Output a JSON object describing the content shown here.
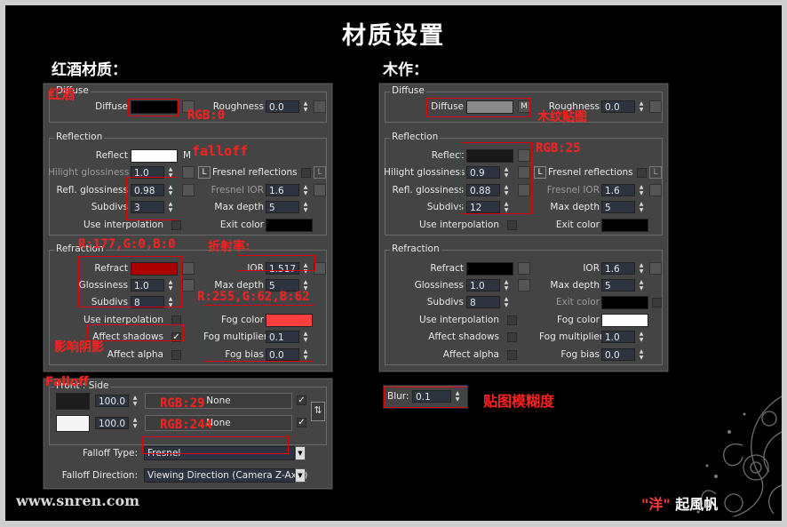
{
  "title": "材质设置",
  "left_heading": "红酒材质：",
  "right_heading": "木作：",
  "footer_site": "www.snren.com",
  "footer_author_q": "\"洋\"",
  "footer_author_rest": "起風帆",
  "colors": {
    "wine_refract": "#aa0000",
    "fog_color_wine": "#ff3e3e",
    "annotation": "#ff2020"
  },
  "left": {
    "diffuse_group": "Diffuse",
    "diffuse_label": "Diffuse",
    "roughness_label": "Roughness",
    "roughness_value": "0.0",
    "reflection_group": "Reflection",
    "reflect_label": "Reflect",
    "m_label": "M",
    "hilight_label": "Hilight glossiness",
    "hilight_value": "1.0",
    "l_label": "L",
    "fresnel_label": "Fresnel reflections",
    "refl_gloss_label": "Refl. glossiness",
    "refl_gloss_value": "0.98",
    "fresnel_ior_label": "Fresnel IOR",
    "fresnel_ior_value": "1.6",
    "subdivs_label": "Subdivs",
    "subdivs_value": "3",
    "max_depth_label": "Max depth",
    "max_depth_value": "5",
    "use_interp_label": "Use interpolation",
    "exit_color_label": "Exit color",
    "refraction_group": "Refraction",
    "refract_label": "Refract",
    "ior_label": "IOR",
    "ior_value": "1.517",
    "glossiness_label": "Glossiness",
    "glossiness_value": "1.0",
    "r_max_depth_label": "Max depth",
    "r_max_depth_value": "5",
    "r_subdivs_label": "Subdivs",
    "r_subdivs_value": "8",
    "r_use_interp_label": "Use interpolation",
    "fog_color_label": "Fog color",
    "affect_shadows_label": "Affect shadows",
    "fog_mult_label": "Fog multiplier",
    "fog_mult_value": "0.1",
    "affect_alpha_label": "Affect alpha",
    "fog_bias_label": "Fog bias",
    "fog_bias_value": "0.0"
  },
  "falloff": {
    "group": "Front : Side",
    "val1": "100.0",
    "none1": "None",
    "val2": "100.0",
    "none2": "None",
    "type_label": "Falloff Type:",
    "type_value": "Fresnel",
    "dir_label": "Falloff Direction:",
    "dir_value": "Viewing Direction (Camera Z-Axis)"
  },
  "right": {
    "diffuse_group": "Diffuse",
    "diffuse_label": "Diffuse",
    "m_label": "M",
    "roughness_label": "Roughness",
    "roughness_value": "0.0",
    "reflection_group": "Reflection",
    "reflect_label": "Reflect",
    "hilight_label": "Hilight glossiness",
    "hilight_value": "0.9",
    "l_label": "L",
    "fresnel_label": "Fresnel reflections",
    "refl_gloss_label": "Refl. glossiness",
    "refl_gloss_value": "0.88",
    "fresnel_ior_label": "Fresnel IOR",
    "fresnel_ior_value": "1.6",
    "subdivs_label": "Subdivs",
    "subdivs_value": "12",
    "max_depth_label": "Max depth",
    "max_depth_value": "5",
    "use_interp_label": "Use interpolation",
    "exit_color_label": "Exit color",
    "refraction_group": "Refraction",
    "refract_label": "Refract",
    "ior_label": "IOR",
    "ior_value": "1.6",
    "glossiness_label": "Glossiness",
    "glossiness_value": "1.0",
    "r_max_depth_label": "Max depth",
    "r_max_depth_value": "5",
    "r_subdivs_label": "Subdivs",
    "r_subdivs_value": "8",
    "r_exit_color_label": "Exit color",
    "r_use_interp_label": "Use interpolation",
    "fog_color_label": "Fog color",
    "affect_shadows_label": "Affect shadows",
    "fog_mult_label": "Fog multiplier",
    "fog_mult_value": "1.0",
    "affect_alpha_label": "Affect alpha",
    "fog_bias_label": "Fog bias",
    "fog_bias_value": "0.0"
  },
  "blur": {
    "label": "Blur:",
    "value": "0.1"
  },
  "annotations": {
    "red_wine": "红酒",
    "rgb0": "RGB:0",
    "falloff": "falloff",
    "r177": "R:177,G:0,B:0",
    "ior_text": "折射率:",
    "fog_rgb": "R:255,G:62,B:62",
    "shadow_text": "影响阴影",
    "falloff2": "Falloff",
    "rgb29": "RGB:29",
    "rgb244": "RGB:244",
    "wood_map": "木纹贴图",
    "rgb25": "RGB:25",
    "blur_text": "贴图模糊度"
  }
}
